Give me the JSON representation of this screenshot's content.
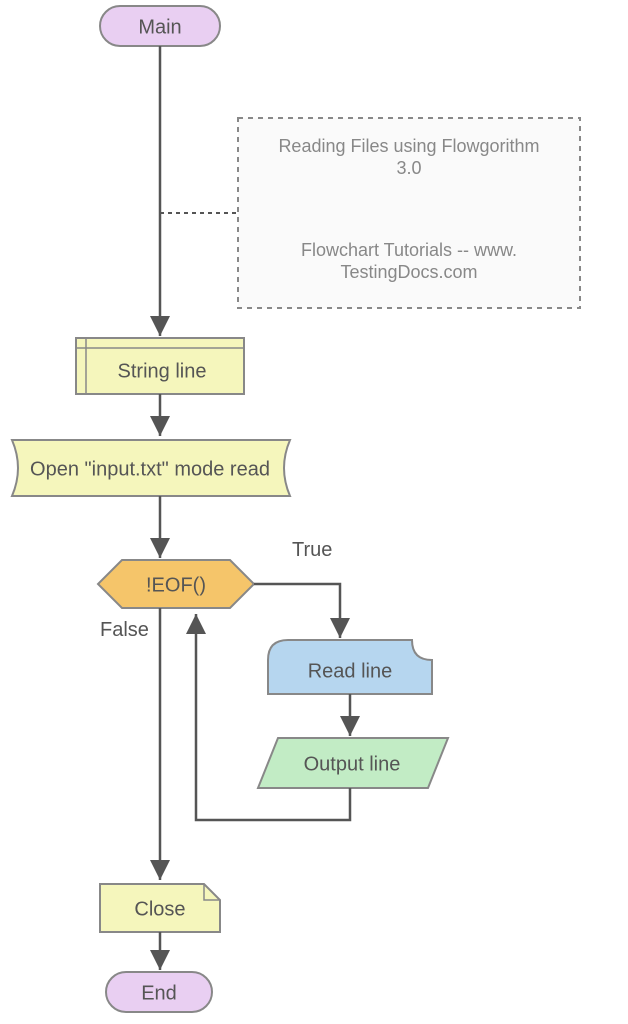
{
  "terminal_start": "Main",
  "terminal_end": "End",
  "declare": "String line",
  "file_open": "Open \"input.txt\" mode read",
  "decision": "!EOF()",
  "decision_true": "True",
  "decision_false": "False",
  "read": "Read line",
  "output": "Output line",
  "file_close": "Close",
  "note_title_line1": "Reading Files using Flowgorithm",
  "note_title_line2": "3.0",
  "note_sub_line1": "Flowchart Tutorials -- www.",
  "note_sub_line2": "TestingDocs.com"
}
